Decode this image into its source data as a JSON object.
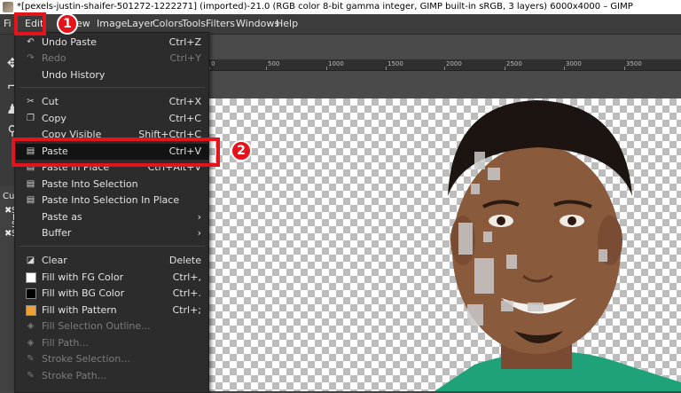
{
  "window": {
    "title": "*[pexels-justin-shaifer-501272-1222271] (imported)-21.0 (RGB color 8-bit gamma integer, GIMP built-in sRGB, 3 layers) 6000x4000 – GIMP"
  },
  "menubar": {
    "file": "Fi",
    "edit": "Edit",
    "select": "S",
    "view": "ew",
    "image": "Image",
    "layer": "Layer",
    "colors": "Colors",
    "tools": "Tools",
    "filters": "Filters",
    "windows": "Windows",
    "help": "Help"
  },
  "ruler": {
    "ticks": [
      "0",
      "500",
      "1000",
      "1500",
      "2000",
      "2500",
      "3000",
      "3500"
    ]
  },
  "left_panel": {
    "curves_label": "Curv",
    "letters": [
      "S",
      "S",
      "Ra",
      "S"
    ]
  },
  "edit_menu": {
    "undo_paste": {
      "label": "Undo Paste",
      "shortcut": "Ctrl+Z"
    },
    "redo": {
      "label": "Redo",
      "shortcut": "Ctrl+Y"
    },
    "undo_history": {
      "label": "Undo History"
    },
    "cut": {
      "label": "Cut",
      "shortcut": "Ctrl+X"
    },
    "copy": {
      "label": "Copy",
      "shortcut": "Ctrl+C"
    },
    "copy_visible": {
      "label": "Copy Visible",
      "shortcut": "Shift+Ctrl+C"
    },
    "paste": {
      "label": "Paste",
      "shortcut": "Ctrl+V"
    },
    "paste_in_place": {
      "label": "Paste In Place",
      "shortcut": "Ctrl+Alt+V"
    },
    "paste_into_selection": {
      "label": "Paste Into Selection"
    },
    "paste_into_selection_in_place": {
      "label": "Paste Into Selection In Place"
    },
    "paste_as": {
      "label": "Paste as"
    },
    "buffer": {
      "label": "Buffer"
    },
    "clear": {
      "label": "Clear",
      "shortcut": "Delete"
    },
    "fill_fg": {
      "label": "Fill with FG Color",
      "shortcut": "Ctrl+,"
    },
    "fill_bg": {
      "label": "Fill with BG Color",
      "shortcut": "Ctrl+."
    },
    "fill_pattern": {
      "label": "Fill with Pattern",
      "shortcut": "Ctrl+;"
    },
    "fill_selection_outline": {
      "label": "Fill Selection Outline..."
    },
    "fill_path": {
      "label": "Fill Path..."
    },
    "stroke_selection": {
      "label": "Stroke Selection..."
    },
    "stroke_path": {
      "label": "Stroke Path..."
    }
  },
  "annotations": {
    "step1": "1",
    "step2": "2"
  },
  "colors": {
    "highlight": "#e5141b",
    "fg_swatch": "#ffffff",
    "bg_swatch": "#000000",
    "pattern_swatch": "#f0a030"
  }
}
